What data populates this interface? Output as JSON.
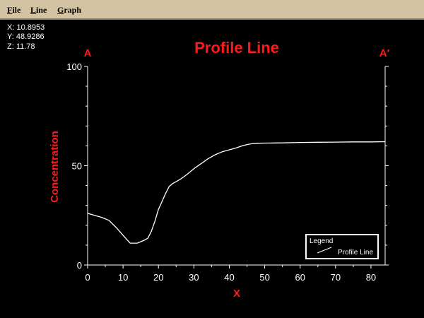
{
  "menu": {
    "items": [
      {
        "label": "File"
      },
      {
        "label": "Line"
      },
      {
        "label": "Graph"
      }
    ]
  },
  "readout": {
    "x": "X: 10.8953",
    "y": "Y: 48.9286",
    "z": "Z: 11.78"
  },
  "colors": {
    "background": "#000000",
    "menubar": "#d4c3a3",
    "accent_red": "#ff1a1a",
    "axis": "#ffffff"
  },
  "chart_data": {
    "type": "line",
    "title": "Profile Line",
    "xlabel": "X",
    "ylabel": "Concentration",
    "start_label": "A",
    "end_label": "A′",
    "xlim": [
      0,
      84
    ],
    "ylim": [
      0,
      100
    ],
    "x_ticks": [
      0,
      10,
      20,
      30,
      40,
      50,
      60,
      70,
      80
    ],
    "y_ticks": [
      0,
      50,
      100
    ],
    "grid": false,
    "legend": {
      "title": "Legend",
      "placement": "bottom-right",
      "entries": [
        "Profile Line"
      ]
    },
    "series": [
      {
        "name": "Profile Line",
        "x": [
          0,
          2,
          4,
          6,
          8,
          10,
          12,
          14,
          16,
          17,
          18,
          19,
          20,
          21,
          22,
          23,
          24,
          26,
          28,
          30,
          32,
          34,
          36,
          38,
          40,
          42,
          44,
          46,
          48,
          50,
          55,
          60,
          65,
          70,
          75,
          80,
          84
        ],
        "y": [
          26,
          25,
          24,
          22.5,
          19,
          15,
          11,
          11,
          12.5,
          13.5,
          17,
          22,
          28,
          32,
          36,
          39.5,
          41,
          43,
          45.5,
          48.5,
          51,
          53.5,
          55.5,
          57,
          58,
          59,
          60.2,
          61,
          61.3,
          61.4,
          61.5,
          61.7,
          61.8,
          61.9,
          62,
          62,
          62.1
        ]
      }
    ]
  }
}
